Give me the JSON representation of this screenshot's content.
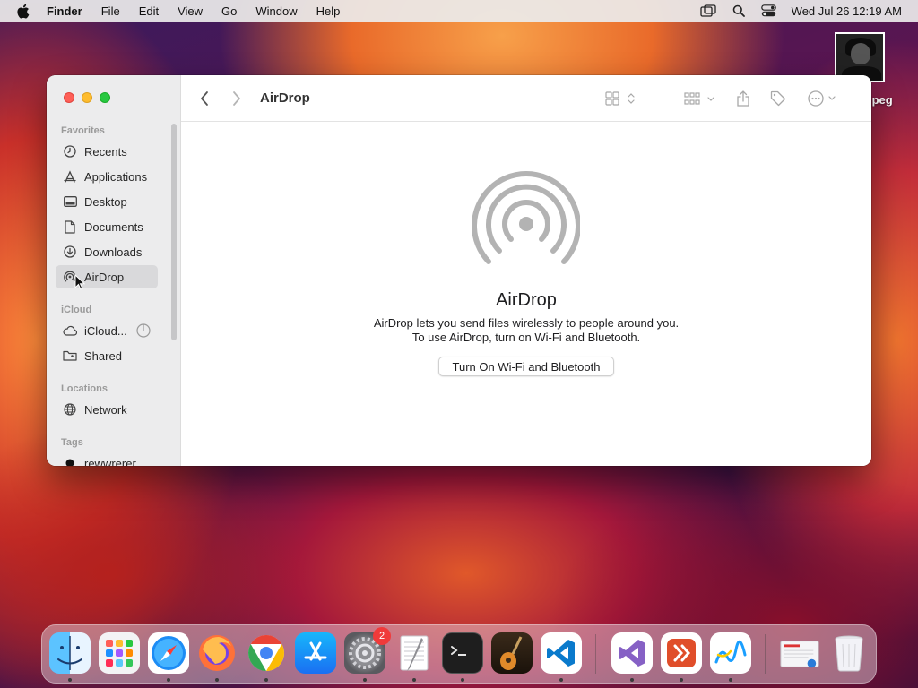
{
  "menubar": {
    "app_name": "Finder",
    "menus": [
      "File",
      "Edit",
      "View",
      "Go",
      "Window",
      "Help"
    ],
    "clock": "Wed Jul 26  12:19 AM"
  },
  "desktop": {
    "file_label": "jpeg"
  },
  "finder": {
    "location_title": "AirDrop",
    "sidebar": {
      "favorites_label": "Favorites",
      "favorites": [
        "Recents",
        "Applications",
        "Desktop",
        "Documents",
        "Downloads",
        "AirDrop"
      ],
      "icloud_label": "iCloud",
      "icloud": [
        "iCloud...",
        "Shared"
      ],
      "locations_label": "Locations",
      "locations": [
        "Network"
      ],
      "tags_label": "Tags",
      "tags": [
        "rewwrerer"
      ]
    },
    "airdrop": {
      "title": "AirDrop",
      "desc_line1": "AirDrop lets you send files wirelessly to people around you.",
      "desc_line2": "To use AirDrop, turn on Wi-Fi and Bluetooth.",
      "button_label": "Turn On Wi-Fi and Bluetooth"
    }
  },
  "dock": {
    "apps": [
      "finder-icon",
      "launchpad-icon",
      "safari-icon",
      "firefox-icon",
      "chrome-icon",
      "app-store-icon",
      "system-settings-icon",
      "textedit-icon",
      "terminal-icon",
      "instruments-icon",
      "vscode-icon",
      "visual-studio-icon",
      "remote-desktop-icon",
      "freeform-icon",
      "preview-icon",
      "trash-icon"
    ],
    "settings_badge": "2"
  },
  "colors": {
    "close": "#fe5f57",
    "minimize": "#febc2e",
    "zoom": "#28c840",
    "badge": "#f03a3a"
  }
}
